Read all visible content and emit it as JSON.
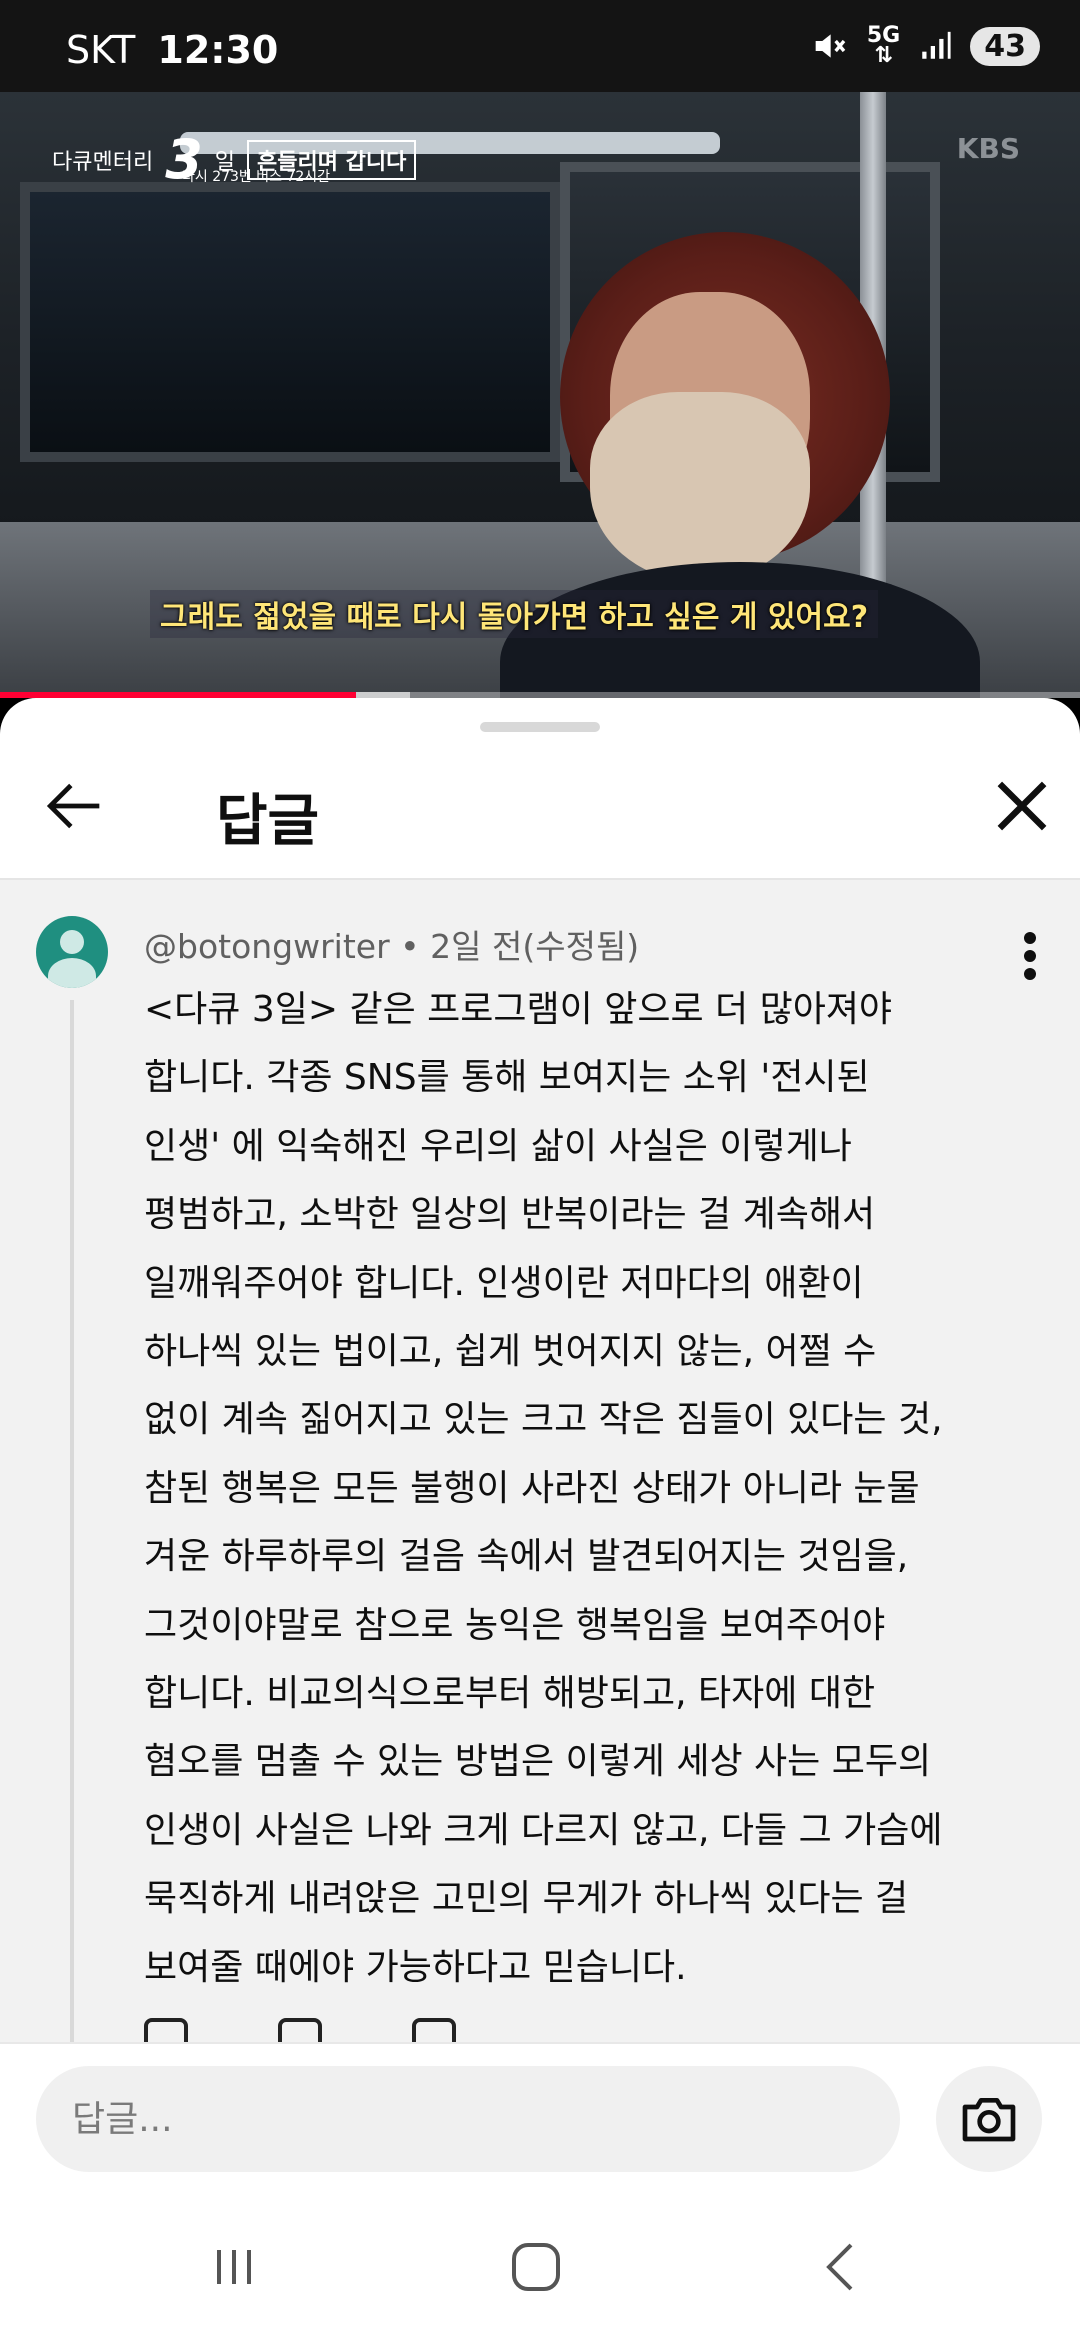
{
  "status_bar": {
    "carrier": "SKT",
    "time": "12:30",
    "network": "5G",
    "battery": "43",
    "icons": [
      "mute-icon",
      "5g-data-icon",
      "signal-icon",
      "battery-icon"
    ]
  },
  "video": {
    "logo_main": "다큐멘터리",
    "logo_number": "3",
    "logo_suffix": "일",
    "logo_box": "흔들리며 갑니다",
    "logo_sub": "다시 273번 버스 72시간",
    "watermark": "KBS",
    "subtitle": "그래도 젊었을 때로 다시 돌아가면 하고 싶은 게 있어요?",
    "progress_fraction": 0.33,
    "buffered_fraction": 0.38,
    "colors": {
      "progress": "#ff0033",
      "subtitle": "#ffe678"
    }
  },
  "sheet": {
    "title": "답글",
    "back_icon": "arrow-left-icon",
    "close_icon": "close-icon"
  },
  "comment": {
    "author": "@botongwriter",
    "separator": "•",
    "time": "2일 전(수정됨)",
    "more_icon": "more-vertical-icon",
    "lines": [
      "<다큐 3일> 같은 프로그램이 앞으로 더 많아져야",
      "합니다. 각종 SNS를 통해 보여지는 소위 '전시된",
      "인생' 에 익숙해진 우리의 삶이 사실은 이렇게나",
      "평범하고, 소박한 일상의 반복이라는 걸 계속해서",
      "일깨워주어야 합니다. 인생이란 저마다의 애환이",
      "하나씩 있는 법이고, 쉽게 벗어지지 않는, 어쩔 수",
      "없이 계속 짊어지고 있는 크고 작은 짐들이 있다는 것,",
      "참된 행복은 모든 불행이 사라진 상태가 아니라 눈물",
      "겨운 하루하루의 걸음 속에서 발견되어지는 것임을,",
      "그것이야말로 참으로 농익은 행복임을 보여주어야",
      "합니다. 비교의식으로부터 해방되고, 타자에 대한",
      "혐오를 멈출 수 있는 방법은 이렇게 세상 사는 모두의",
      "인생이 사실은 나와 크게 다르지 않고, 다들 그 가슴에",
      "묵직하게 내려앉은 고민의 무게가 하나씩 있다는 걸",
      "보여줄 때에야 가능하다고 믿습니다."
    ],
    "avatar_color": "#1f8f80"
  },
  "reply_bar": {
    "placeholder": "답글...",
    "camera_icon": "camera-icon"
  },
  "nav_bar": {
    "icons": [
      "recent-apps-icon",
      "home-icon",
      "back-icon"
    ]
  }
}
